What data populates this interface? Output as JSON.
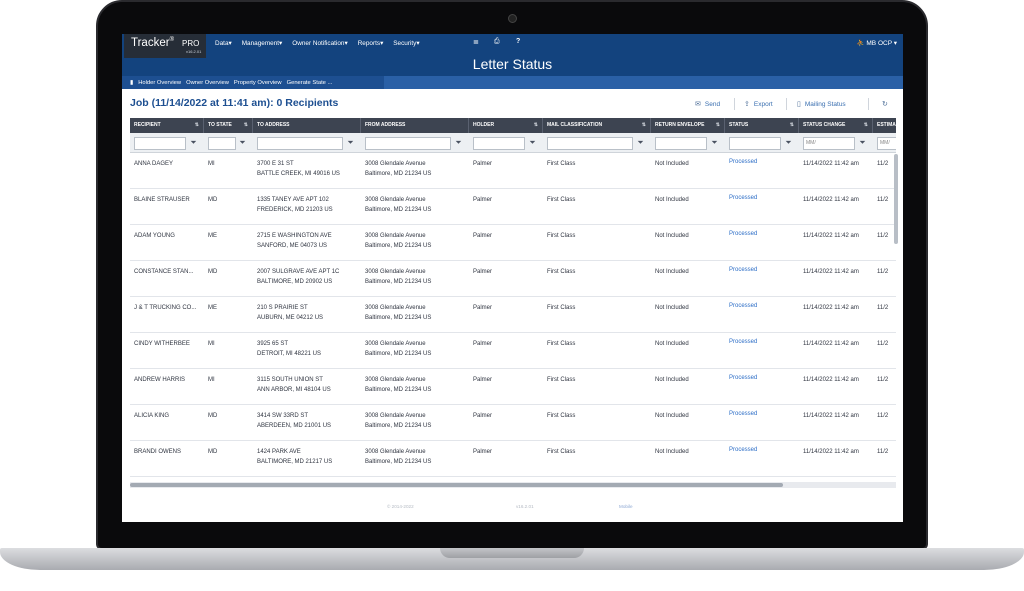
{
  "app": {
    "brand": "Tracker",
    "brand_mark": "®",
    "edition": "PRO",
    "version": "v16.2.01"
  },
  "nav": {
    "items": [
      "Data",
      "Management",
      "Owner Notification",
      "Reports",
      "Security"
    ],
    "icons": [
      "list-icon",
      "print-icon",
      "help-icon"
    ],
    "help_label": "?",
    "user": "MB OCP"
  },
  "page": {
    "title": "Letter Status"
  },
  "tabs": [
    "Holder Overview",
    "Owner Overview",
    "Property Overview",
    "Generate State ..."
  ],
  "job": {
    "heading": "Job (11/14/2022 at 11:41 am): 0 Recipients"
  },
  "actions": {
    "send": "Send",
    "export": "Export",
    "mailing_status": "Mailing Status"
  },
  "table": {
    "columns": [
      "RECIPIENT",
      "TO STATE",
      "TO ADDRESS",
      "FROM ADDRESS",
      "HOLDER",
      "MAIL CLASSIFICATION",
      "RETURN ENVELOPE",
      "STATUS",
      "STATUS CHANGE",
      "ESTIMA"
    ],
    "date_placeholder": "MM/",
    "date_placeholder2": "MM/",
    "rows": [
      {
        "recipient": "ANNA DAGEY",
        "state": "MI",
        "to1": "3700 E 31 ST",
        "to2": "BATTLE CREEK, MI 49016 US",
        "from1": "3008 Glendale Avenue",
        "from2": "Baltimore, MD 21234 US",
        "holder": "Palmer",
        "mail": "First Class",
        "env": "Not Included",
        "status": "Processed",
        "change": "11/14/2022 11:42 am",
        "est": "11/2"
      },
      {
        "recipient": "BLAINE STRAUSER",
        "state": "MD",
        "to1": "1335 TANEY AVE APT 102",
        "to2": "FREDERICK, MD 21203 US",
        "from1": "3008 Glendale Avenue",
        "from2": "Baltimore, MD 21234 US",
        "holder": "Palmer",
        "mail": "First Class",
        "env": "Not Included",
        "status": "Processed",
        "change": "11/14/2022 11:42 am",
        "est": "11/2"
      },
      {
        "recipient": "ADAM YOUNG",
        "state": "ME",
        "to1": "2715 E WASHINGTON AVE",
        "to2": "SANFORD, ME 04073 US",
        "from1": "3008 Glendale Avenue",
        "from2": "Baltimore, MD 21234 US",
        "holder": "Palmer",
        "mail": "First Class",
        "env": "Not Included",
        "status": "Processed",
        "change": "11/14/2022 11:42 am",
        "est": "11/2"
      },
      {
        "recipient": "CONSTANCE STAN...",
        "state": "MD",
        "to1": "2007 SULGRAVE AVE APT 1C",
        "to2": "BALTIMORE, MD 20902 US",
        "from1": "3008 Glendale Avenue",
        "from2": "Baltimore, MD 21234 US",
        "holder": "Palmer",
        "mail": "First Class",
        "env": "Not Included",
        "status": "Processed",
        "change": "11/14/2022 11:42 am",
        "est": "11/2"
      },
      {
        "recipient": "J & T TRUCKING CO...",
        "state": "ME",
        "to1": "210 S PRAIRIE ST",
        "to2": "AUBURN, ME 04212 US",
        "from1": "3008 Glendale Avenue",
        "from2": "Baltimore, MD 21234 US",
        "holder": "Palmer",
        "mail": "First Class",
        "env": "Not Included",
        "status": "Processed",
        "change": "11/14/2022 11:42 am",
        "est": "11/2"
      },
      {
        "recipient": "CINDY WITHERBEE",
        "state": "MI",
        "to1": "3925 65 ST",
        "to2": "DETROIT, MI 48221 US",
        "from1": "3008 Glendale Avenue",
        "from2": "Baltimore, MD 21234 US",
        "holder": "Palmer",
        "mail": "First Class",
        "env": "Not Included",
        "status": "Processed",
        "change": "11/14/2022 11:42 am",
        "est": "11/2"
      },
      {
        "recipient": "ANDREW HARRIS",
        "state": "MI",
        "to1": "3115 SOUTH UNION ST",
        "to2": "ANN ARBOR, MI 48104 US",
        "from1": "3008 Glendale Avenue",
        "from2": "Baltimore, MD 21234 US",
        "holder": "Palmer",
        "mail": "First Class",
        "env": "Not Included",
        "status": "Processed",
        "change": "11/14/2022 11:42 am",
        "est": "11/2"
      },
      {
        "recipient": "ALICIA KING",
        "state": "MD",
        "to1": "3414 SW 33RD ST",
        "to2": "ABERDEEN, MD 21001 US",
        "from1": "3008 Glendale Avenue",
        "from2": "Baltimore, MD 21234 US",
        "holder": "Palmer",
        "mail": "First Class",
        "env": "Not Included",
        "status": "Processed",
        "change": "11/14/2022 11:42 am",
        "est": "11/2"
      },
      {
        "recipient": "BRANDI OWENS",
        "state": "MD",
        "to1": "1424 PARK AVE",
        "to2": "BALTIMORE, MD 21217 US",
        "from1": "3008 Glendale Avenue",
        "from2": "Baltimore, MD 21234 US",
        "holder": "Palmer",
        "mail": "First Class",
        "env": "Not Included",
        "status": "Processed",
        "change": "11/14/2022 11:42 am",
        "est": "11/2"
      }
    ]
  },
  "footer": {
    "copyright": "© 2014-2022",
    "version": "v16.2.01",
    "link": "Mobile"
  },
  "colors": {
    "nav_bg": "#13437e",
    "tabs_bg": "#1d4f91",
    "header_bg": "#3d4451",
    "link": "#2d6ec7"
  }
}
